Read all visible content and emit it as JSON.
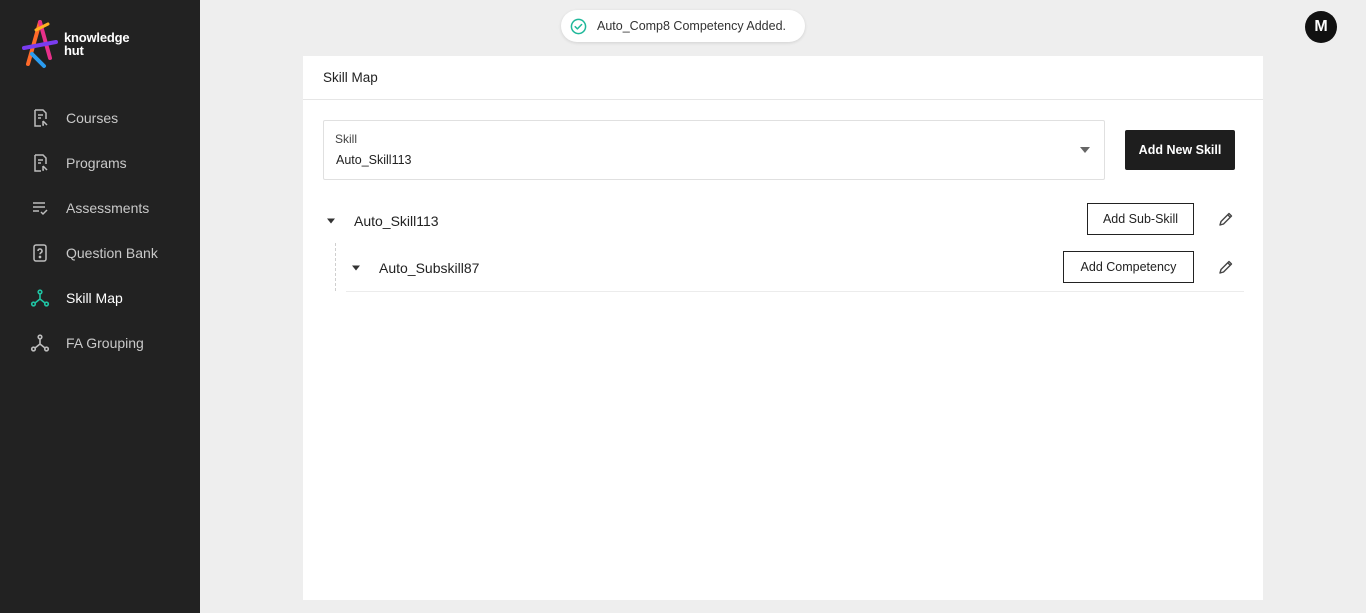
{
  "brand": {
    "line1": "knowledge",
    "line2": "hut"
  },
  "sidebar": {
    "items": [
      {
        "label": "Courses",
        "icon": "document-pointer-icon",
        "active": false
      },
      {
        "label": "Programs",
        "icon": "document-pointer-icon",
        "active": false
      },
      {
        "label": "Assessments",
        "icon": "checklist-icon",
        "active": false
      },
      {
        "label": "Question Bank",
        "icon": "question-square-icon",
        "active": false
      },
      {
        "label": "Skill Map",
        "icon": "network-icon",
        "active": true
      },
      {
        "label": "FA Grouping",
        "icon": "network-icon",
        "active": false
      }
    ]
  },
  "toast": {
    "message": "Auto_Comp8 Competency Added.",
    "icon": "check-circle-icon",
    "color": "#1fb89a"
  },
  "user": {
    "avatar_letter": "M"
  },
  "page": {
    "title": "Skill Map",
    "skill_select": {
      "label": "Skill",
      "value": "Auto_Skill113"
    },
    "add_skill_button": "Add New Skill",
    "skill": {
      "name": "Auto_Skill113",
      "add_subskill_button": "Add Sub-Skill",
      "subskill": {
        "name": "Auto_Subskill87",
        "add_competency_button": "Add Competency"
      }
    }
  },
  "colors": {
    "sidebar_bg": "#222222",
    "active_icon": "#1fc4a3",
    "page_bg": "#eeeeee",
    "primary_button": "#1e1e1e"
  }
}
